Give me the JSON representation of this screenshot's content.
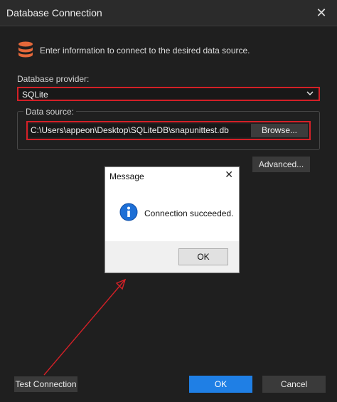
{
  "window": {
    "title": "Database Connection",
    "close_glyph": "✕"
  },
  "intro": {
    "icon": "database-icon",
    "text": "Enter information to connect to the desired data source."
  },
  "provider": {
    "label": "Database provider:",
    "selected": "SQLite",
    "chevron": "chevron-down-icon"
  },
  "data_source": {
    "label": "Data source:",
    "path": "C:\\Users\\appeon\\Desktop\\SQLiteDB\\snapunittest.db",
    "browse_label": "Browse..."
  },
  "advanced_label": "Advanced...",
  "message": {
    "title": "Message",
    "close_glyph": "✕",
    "icon": "info-icon",
    "text": "Connection succeeded.",
    "ok_label": "OK"
  },
  "footer": {
    "test_label": "Test Connection",
    "ok_label": "OK",
    "cancel_label": "Cancel"
  },
  "colors": {
    "highlight": "#d42027",
    "accent": "#1f7fe5",
    "background": "#1f1f1f",
    "icon_orange": "#e4683a"
  }
}
